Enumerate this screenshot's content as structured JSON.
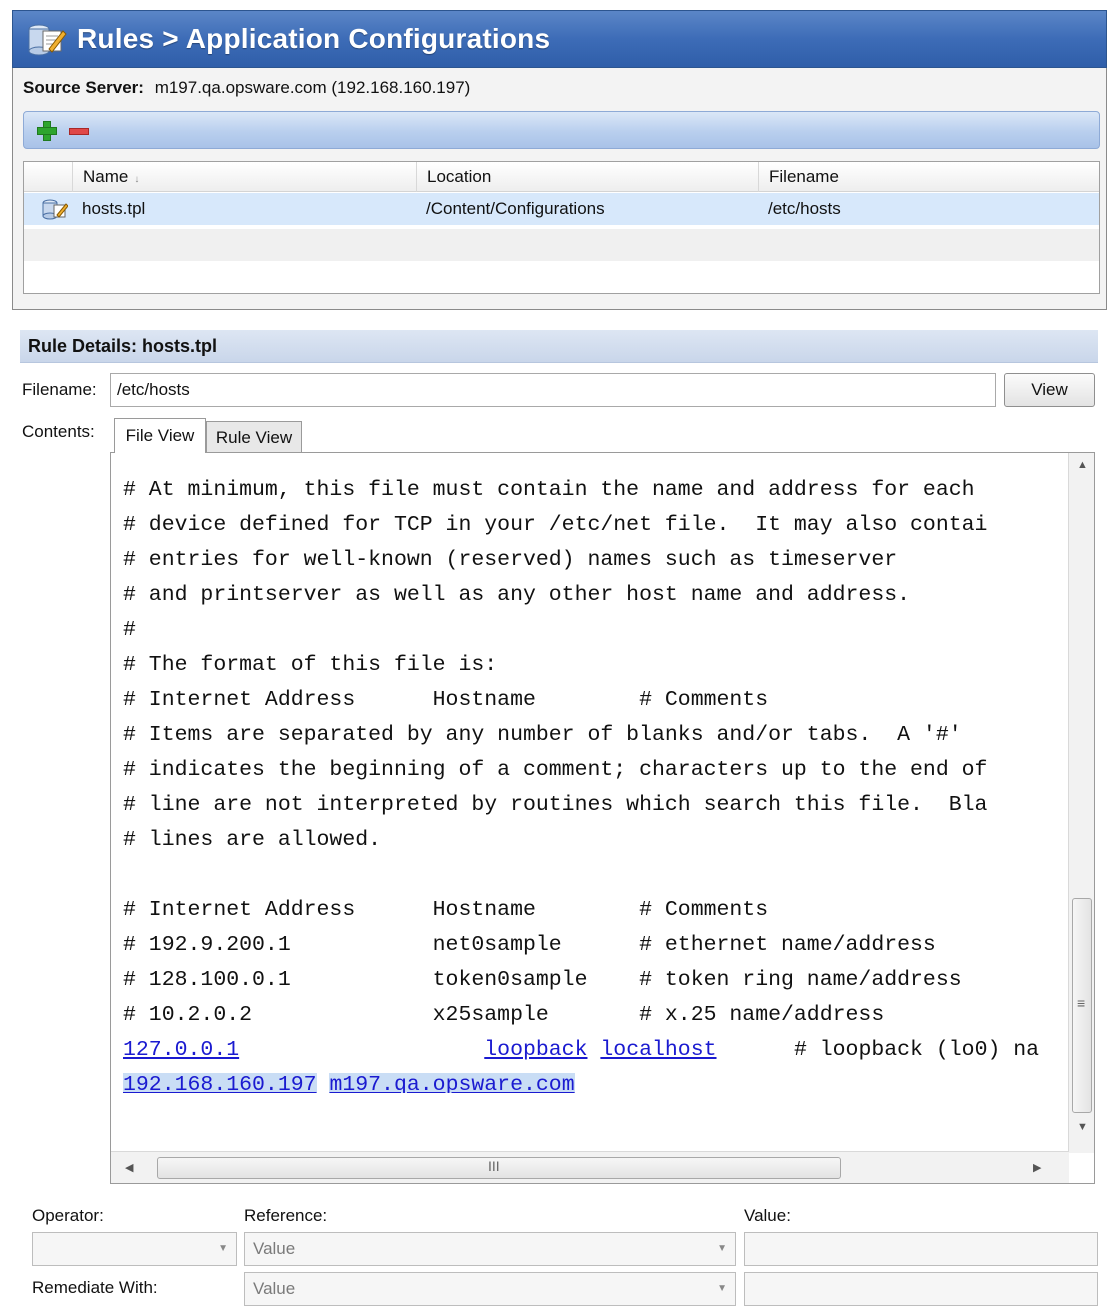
{
  "title": "Rules > Application Configurations",
  "source_server": {
    "label": "Source Server:",
    "value": "m197.qa.opsware.com (192.168.160.197)"
  },
  "toolbar": {
    "add_icon": "plus-icon",
    "remove_icon": "minus-icon"
  },
  "table": {
    "columns": [
      "Name",
      "Location",
      "Filename"
    ],
    "sort_indicator": "↓",
    "rows": [
      {
        "name": "hosts.tpl",
        "location": "/Content/Configurations",
        "filename": "/etc/hosts"
      }
    ]
  },
  "rule_details": {
    "header": "Rule Details: hosts.tpl",
    "filename_label": "Filename:",
    "filename_value": "/etc/hosts",
    "view_button": "View",
    "contents_label": "Contents:",
    "tabs": [
      "File View",
      "Rule View"
    ],
    "active_tab": "File View"
  },
  "file_lines": [
    "# At minimum, this file must contain the name and address for each",
    "# device defined for TCP in your /etc/net file.  It may also contai",
    "# entries for well-known (reserved) names such as timeserver",
    "# and printserver as well as any other host name and address.",
    "#",
    "# The format of this file is:",
    "# Internet Address      Hostname        # Comments",
    "# Items are separated by any number of blanks and/or tabs.  A '#'",
    "# indicates the beginning of a comment; characters up to the end of",
    "# line are not interpreted by routines which search this file.  Bla",
    "# lines are allowed.",
    "",
    "# Internet Address      Hostname        # Comments",
    "# 192.9.200.1           net0sample      # ethernet name/address",
    "# 128.100.0.1           token0sample    # token ring name/address",
    "# 10.2.0.2              x25sample       # x.25 name/address"
  ],
  "link_lines": {
    "loopback_ip": "127.0.0.1",
    "loopback_host1": "loopback",
    "loopback_host2": "localhost",
    "loopback_comment": "# loopback (lo0) na",
    "server_ip": "192.168.160.197",
    "server_host": "m197.qa.opsware.com"
  },
  "bottom": {
    "operator_label": "Operator:",
    "reference_label": "Reference:",
    "value_label": "Value:",
    "remediate_label": "Remediate With:",
    "reference_placeholder": "Value",
    "remediate_placeholder": "Value"
  }
}
